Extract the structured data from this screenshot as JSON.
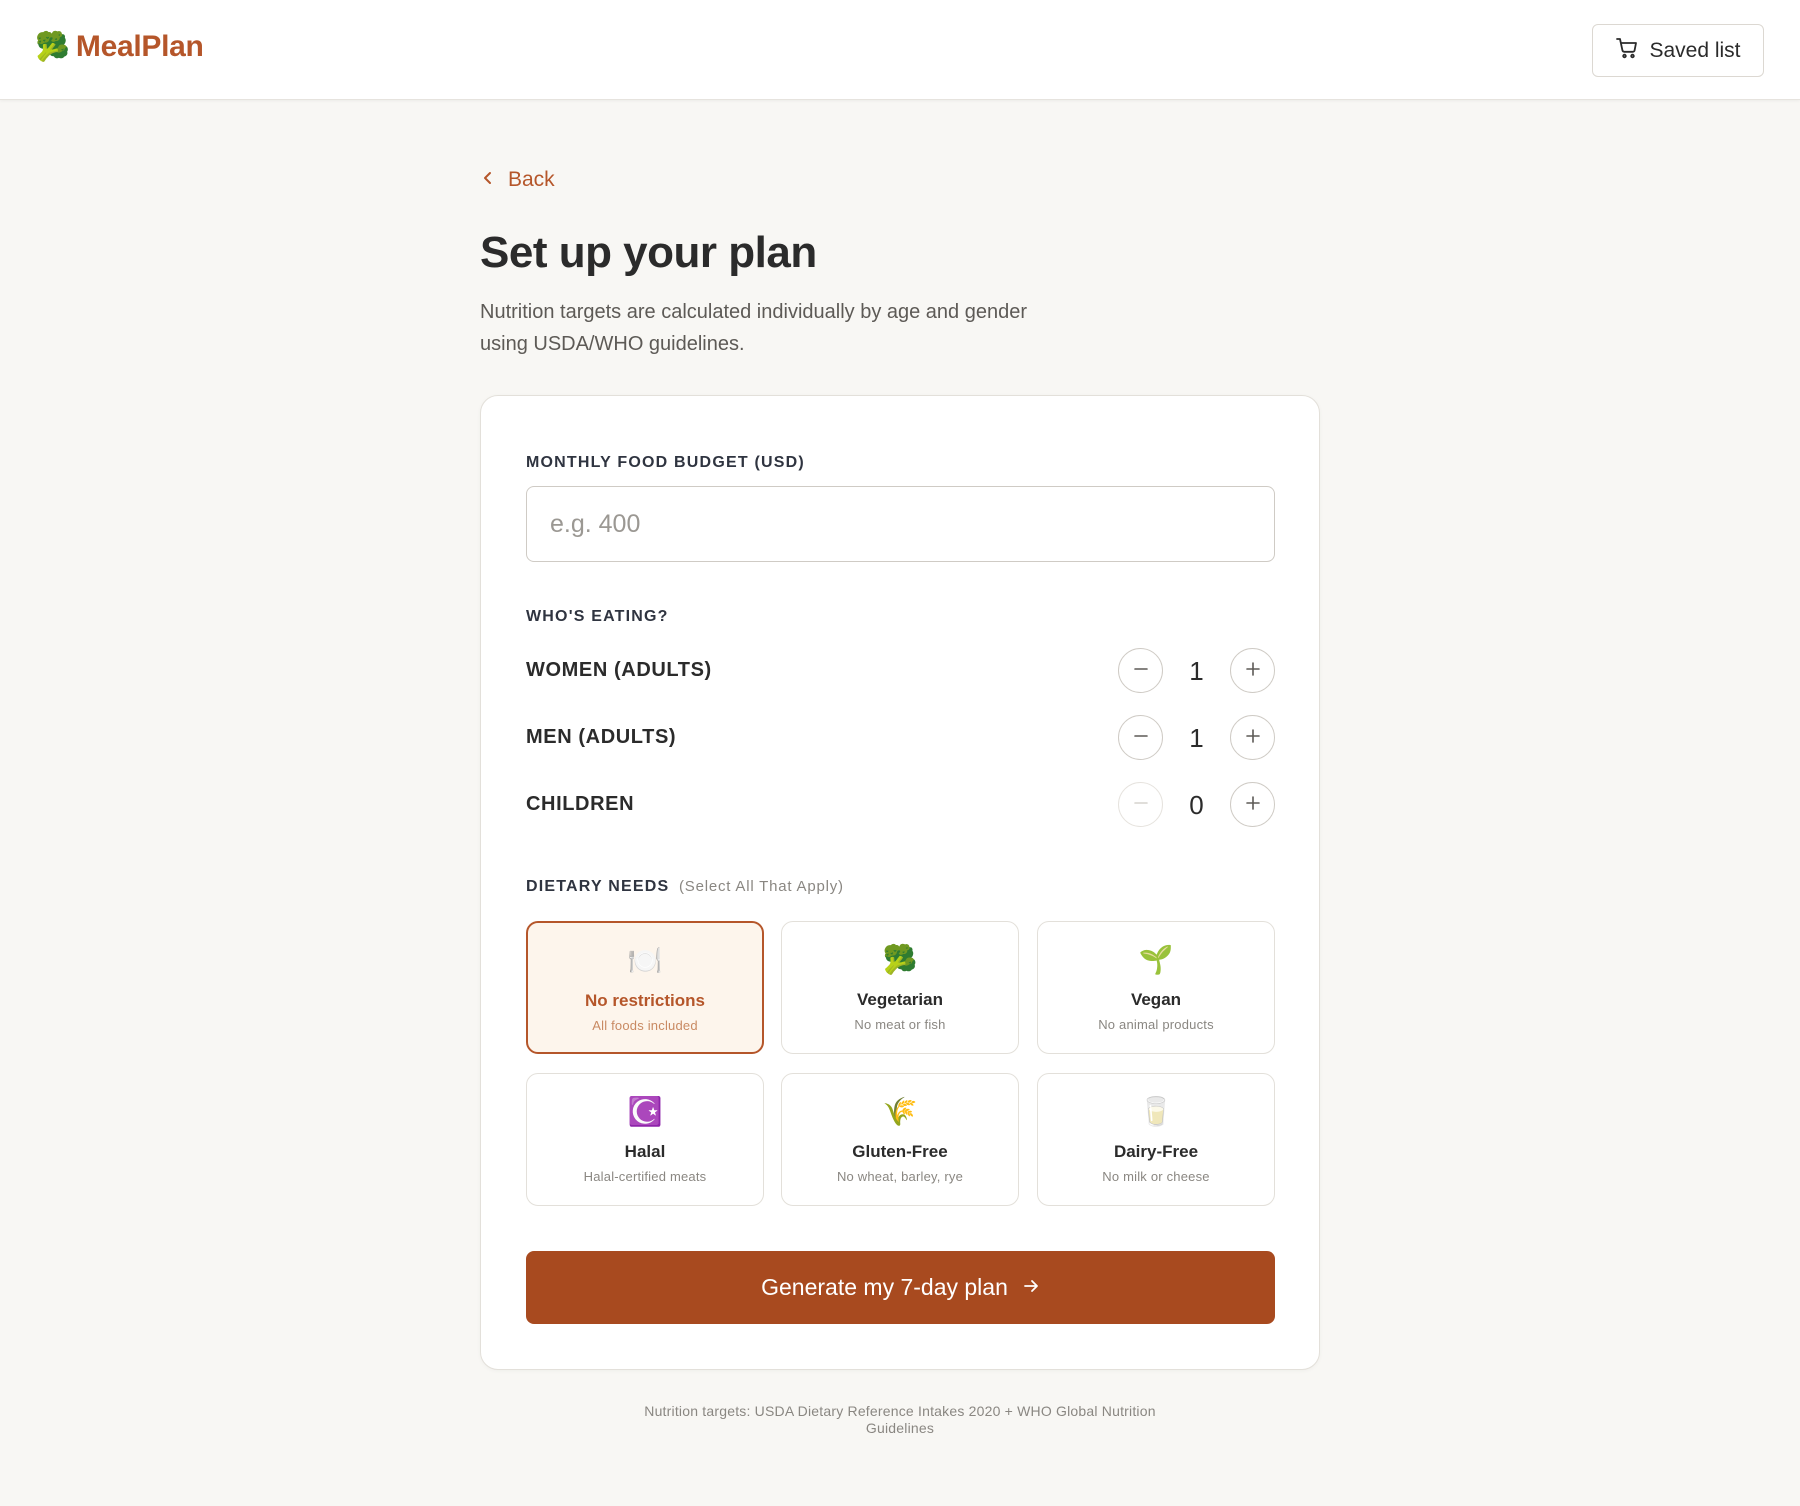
{
  "header": {
    "brand_icon": "🥦",
    "brand_name": "MealPlan",
    "saved_label": "Saved list",
    "saved_icon": "cart-icon"
  },
  "nav": {
    "back_label": "Back"
  },
  "page": {
    "title": "Set up your plan",
    "subtitle": "Nutrition targets are calculated individually by age and gender using USDA/WHO guidelines."
  },
  "budget": {
    "label": "MONTHLY FOOD BUDGET (USD)",
    "placeholder": "e.g. 400",
    "value": ""
  },
  "eaters": {
    "label": "WHO'S EATING?",
    "rows": [
      {
        "label": "WOMEN (ADULTS)",
        "count": "1"
      },
      {
        "label": "MEN (ADULTS)",
        "count": "1"
      },
      {
        "label": "CHILDREN",
        "count": "0"
      }
    ]
  },
  "diet": {
    "label": "DIETARY NEEDS",
    "hint": "(Select All That Apply)",
    "options": [
      {
        "icon": "🍽️",
        "title": "No restrictions",
        "desc": "All foods included",
        "selected": true
      },
      {
        "icon": "🥦",
        "title": "Vegetarian",
        "desc": "No meat or fish",
        "selected": false
      },
      {
        "icon": "🌱",
        "title": "Vegan",
        "desc": "No animal products",
        "selected": false
      },
      {
        "icon": "☪️",
        "title": "Halal",
        "desc": "Halal-certified meats",
        "selected": false
      },
      {
        "icon": "🌾",
        "title": "Gluten-Free",
        "desc": "No wheat, barley, rye",
        "selected": false
      },
      {
        "icon": "🥛",
        "title": "Dairy-Free",
        "desc": "No milk or cheese",
        "selected": false
      }
    ]
  },
  "cta": {
    "label": "Generate my 7-day plan"
  },
  "footer": {
    "note": "Nutrition targets: USDA Dietary Reference Intakes 2020 + WHO Global Nutrition Guidelines"
  },
  "colors": {
    "accent": "#b5562a",
    "cta": "#a84a1f",
    "selected_bg": "#fdf5ec",
    "page_bg": "#f8f7f4"
  }
}
